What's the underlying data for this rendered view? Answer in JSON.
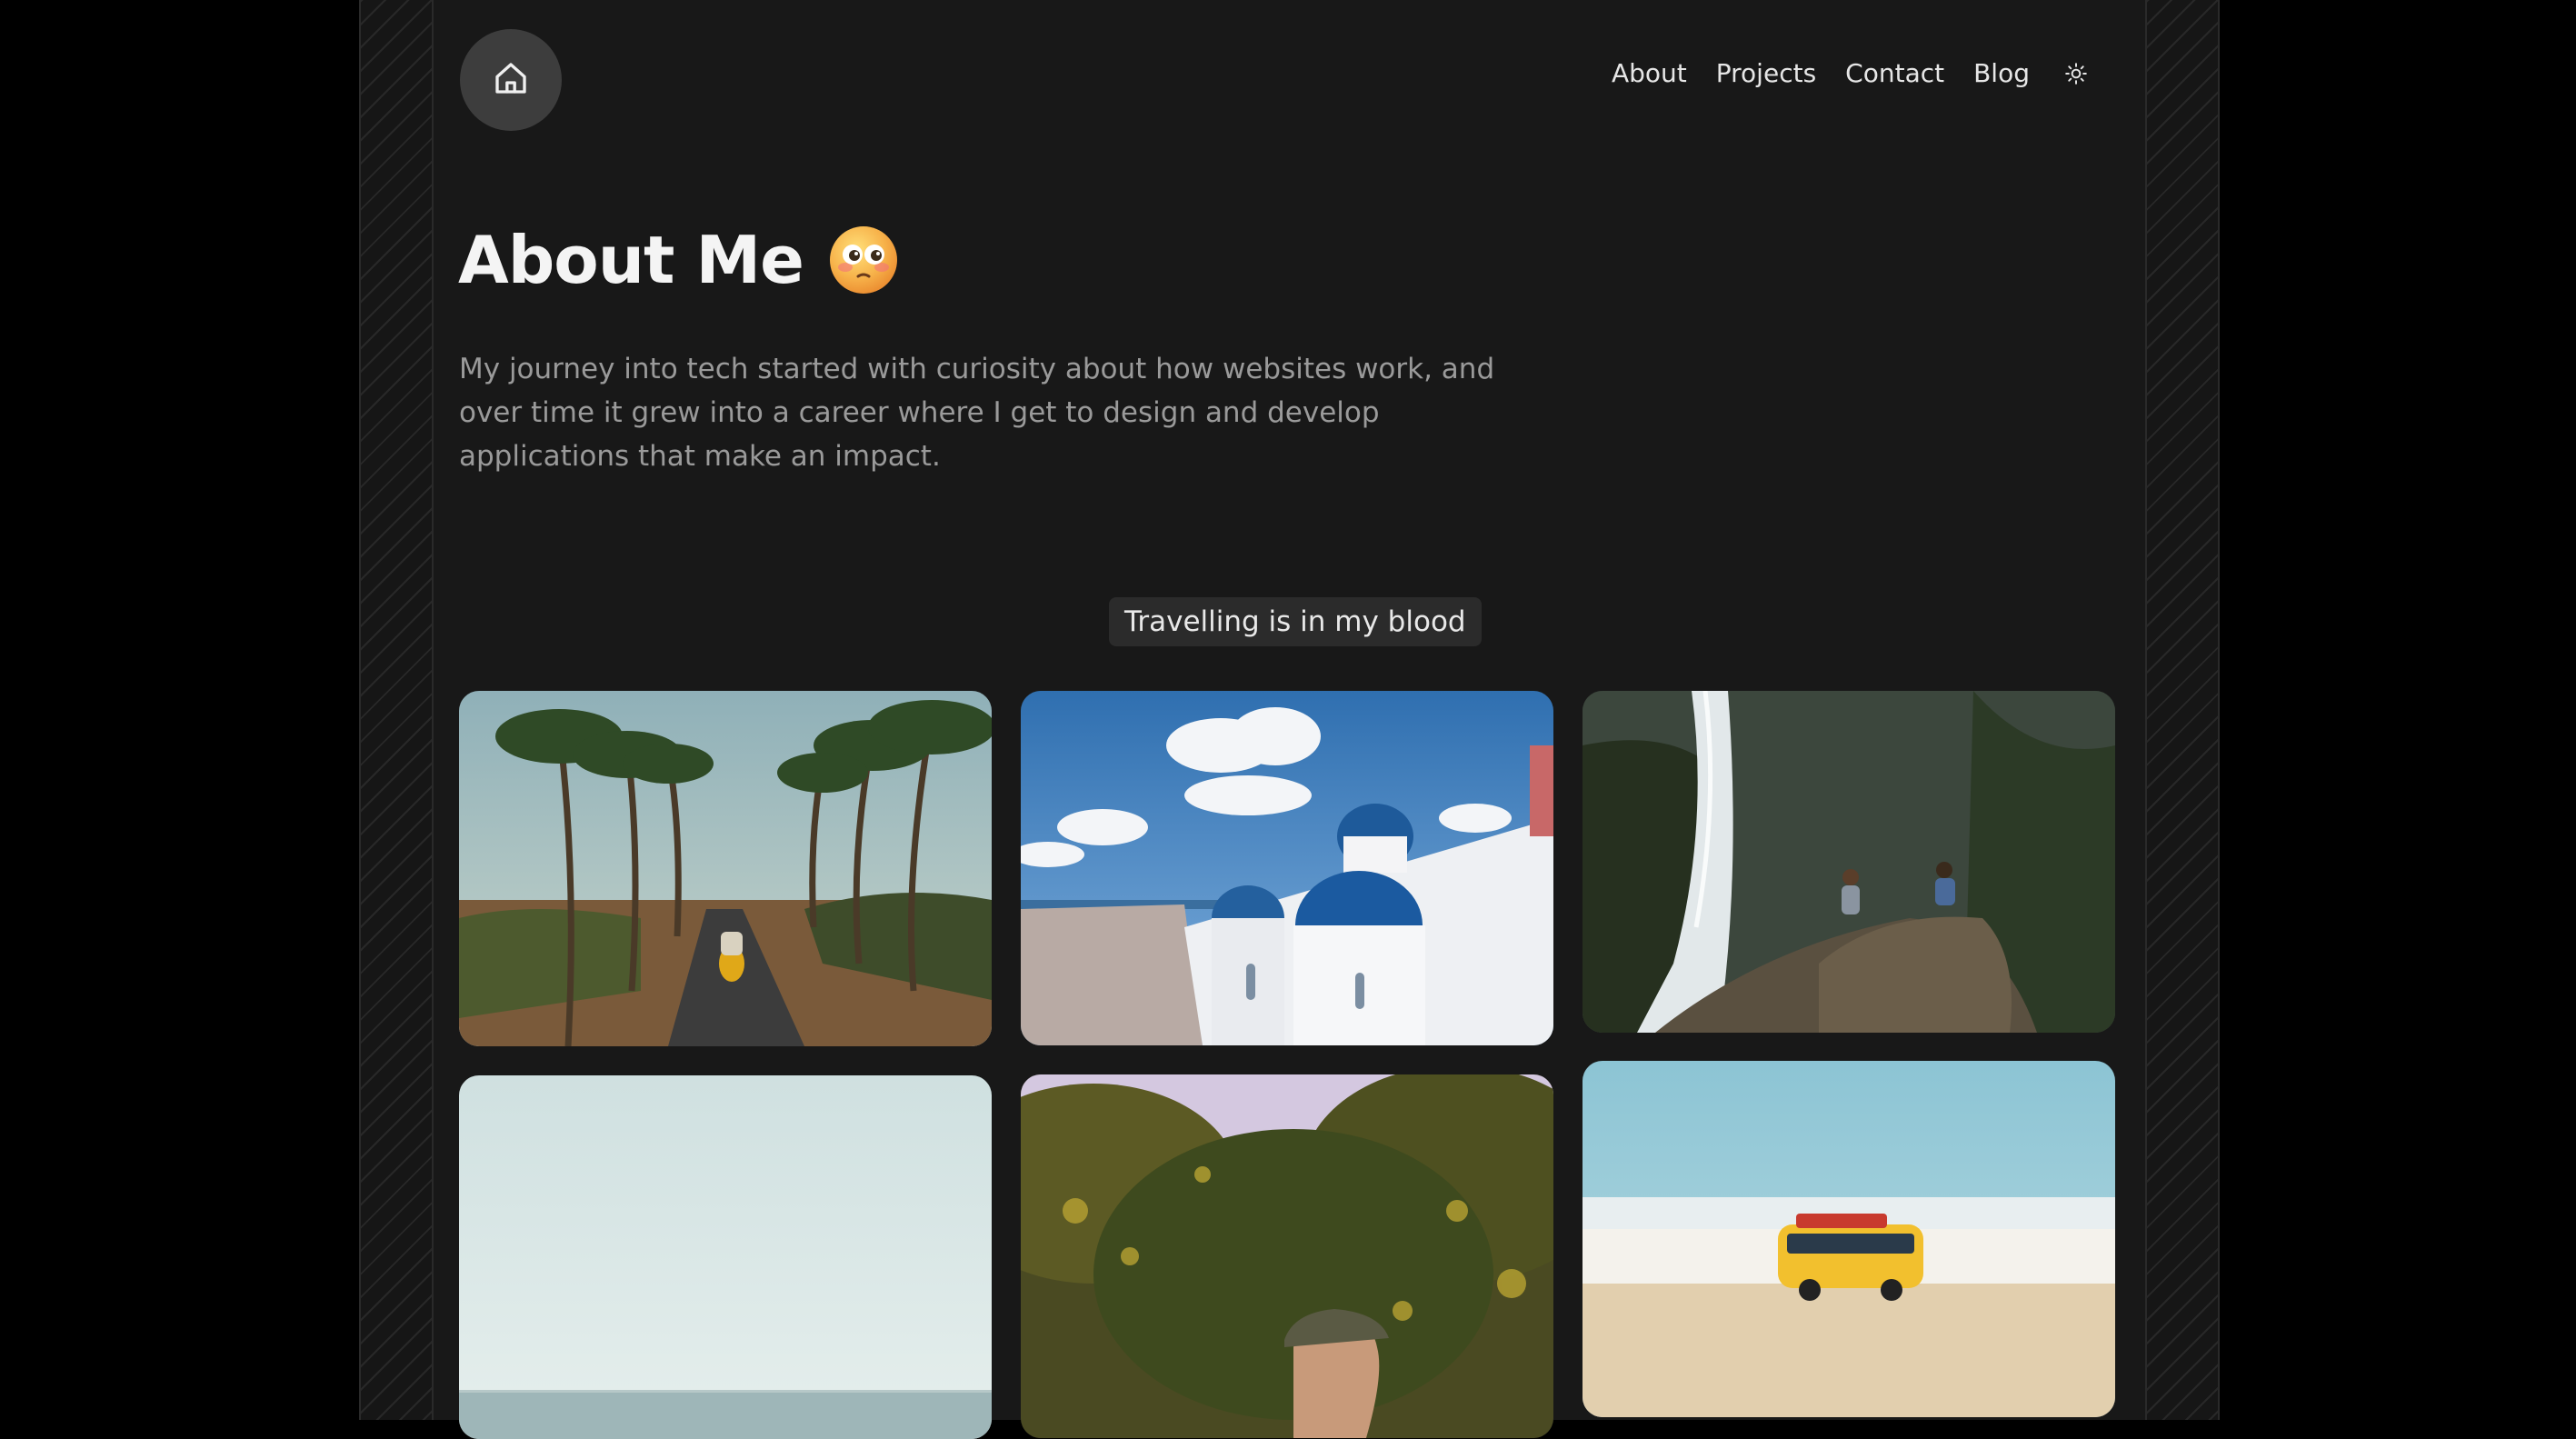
{
  "nav": {
    "items": [
      {
        "label": "About"
      },
      {
        "label": "Projects"
      },
      {
        "label": "Contact"
      },
      {
        "label": "Blog"
      }
    ]
  },
  "hero": {
    "title": "About Me",
    "intro": "My journey into tech started with curiosity about how websites work, and over time it grew into a career where I get to design and develop applications that make an impact."
  },
  "gallery": {
    "heading": "Travelling is in my blood",
    "photos": [
      {
        "name": "scooter-palm-road-photo"
      },
      {
        "name": "santorini-domes-photo"
      },
      {
        "name": "waterfall-rocks-photo"
      },
      {
        "name": "sea-horizon-photo"
      },
      {
        "name": "hiker-forest-photo"
      },
      {
        "name": "toy-van-beach-photo"
      }
    ]
  },
  "colors": {
    "background": "#000000",
    "page": "#181818",
    "home_button": "#3d3d3d",
    "pill": "#2b2b2b",
    "text_primary": "#f4f4f4",
    "text_muted": "#9a9a9a"
  },
  "icons": {
    "home": "home-icon",
    "theme": "sun-icon",
    "title_emoji": "flushed-face-emoji"
  }
}
